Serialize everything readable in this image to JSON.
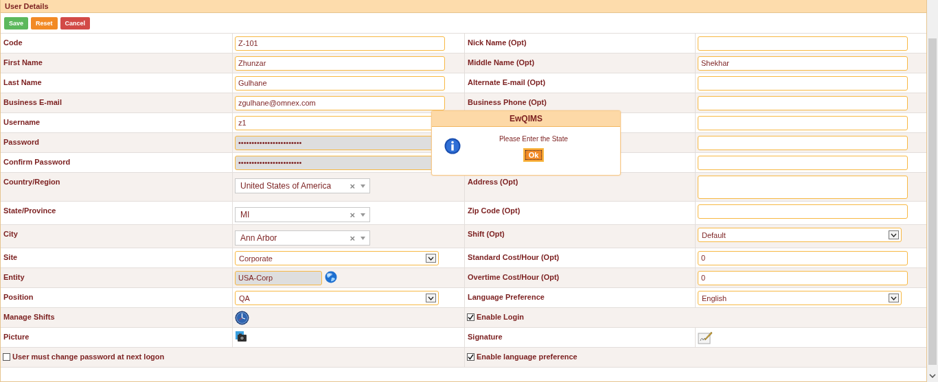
{
  "panel": {
    "title": "User Details"
  },
  "buttons": [
    {
      "label": "Save",
      "kind": "save"
    },
    {
      "label": "Reset",
      "kind": "reset"
    },
    {
      "label": "Cancel",
      "kind": "cancel"
    }
  ],
  "rows": [
    {
      "left": {
        "label": "Code",
        "field": {
          "kind": "text",
          "value": "Z-101"
        }
      },
      "right": {
        "label": "Nick Name (Opt)",
        "field": {
          "kind": "text"
        }
      }
    },
    {
      "left": {
        "label": "First Name",
        "field": {
          "kind": "text",
          "value": "Zhunzar"
        }
      },
      "right": {
        "label": "Middle Name (Opt)",
        "field": {
          "kind": "text",
          "value": "Shekhar"
        }
      }
    },
    {
      "left": {
        "label": "Last Name",
        "field": {
          "kind": "text",
          "value": "Gulhane"
        }
      },
      "right": {
        "label": "Alternate E-mail (Opt)",
        "field": {
          "kind": "text"
        }
      }
    },
    {
      "left": {
        "label": "Business E-mail",
        "field": {
          "kind": "text",
          "value": "zgulhane@omnex.com"
        }
      },
      "right": {
        "label": "Business Phone (Opt)",
        "field": {
          "kind": "text"
        }
      }
    },
    {
      "left": {
        "label": "Username",
        "field": {
          "kind": "text",
          "value": "z1"
        }
      },
      "right": {
        "field": {
          "kind": "text"
        }
      }
    },
    {
      "left": {
        "label": "Password",
        "field": {
          "kind": "password",
          "value": "••••••••••••••••••••••••"
        }
      },
      "right": {
        "field": {
          "kind": "text"
        }
      }
    },
    {
      "left": {
        "label": "Confirm Password",
        "field": {
          "kind": "password",
          "value": "••••••••••••••••••••••••"
        }
      },
      "right": {
        "field": {
          "kind": "text"
        }
      }
    },
    {
      "left": {
        "label": "Country/Region",
        "field": {
          "kind": "combo",
          "value": "United States of America",
          "clear": "×"
        }
      },
      "right": {
        "label": "Address (Opt)",
        "field": {
          "kind": "textarea"
        }
      }
    },
    {
      "left": {
        "label": "State/Province",
        "field": {
          "kind": "combo",
          "value": "MI",
          "clear": "×"
        }
      },
      "right": {
        "label": "Zip Code (Opt)",
        "field": {
          "kind": "text"
        }
      }
    },
    {
      "left": {
        "label": "City",
        "field": {
          "kind": "combo",
          "value": "Ann Arbor",
          "clear": "×"
        }
      },
      "right": {
        "label": "Shift (Opt)",
        "field": {
          "kind": "select",
          "value": "Default"
        }
      }
    },
    {
      "left": {
        "label": "Site",
        "field": {
          "kind": "select",
          "value": "Corporate"
        }
      },
      "right": {
        "label": "Standard Cost/Hour (Opt)",
        "field": {
          "kind": "text",
          "value": "0"
        }
      }
    },
    {
      "left": {
        "label": "Entity",
        "field": {
          "kind": "lookup",
          "value": "USA-Corp"
        }
      },
      "right": {
        "label": "Overtime Cost/Hour (Opt)",
        "field": {
          "kind": "text",
          "value": "0"
        }
      }
    },
    {
      "left": {
        "label": "Position",
        "field": {
          "kind": "select",
          "value": "QA"
        }
      },
      "right": {
        "label": "Language Preference",
        "field": {
          "kind": "select",
          "value": "English"
        }
      }
    },
    {
      "left": {
        "label": "Manage Shifts",
        "field": {
          "kind": "clock"
        }
      },
      "right": {
        "kind": "checkbox",
        "label": "Enable Login",
        "checked": true
      }
    },
    {
      "left": {
        "label": "Picture",
        "field": {
          "kind": "camera"
        }
      },
      "right": {
        "label": "Signature",
        "field": {
          "kind": "signature"
        }
      }
    },
    {
      "left": {
        "kind": "checkbox",
        "label": "User must change password at next logon",
        "checked": false
      },
      "right": {
        "kind": "checkbox",
        "label": "Enable language preference",
        "checked": true
      }
    }
  ],
  "dialog": {
    "title": "EwQIMS",
    "message": "Please Enter the State",
    "button": "Ok"
  }
}
